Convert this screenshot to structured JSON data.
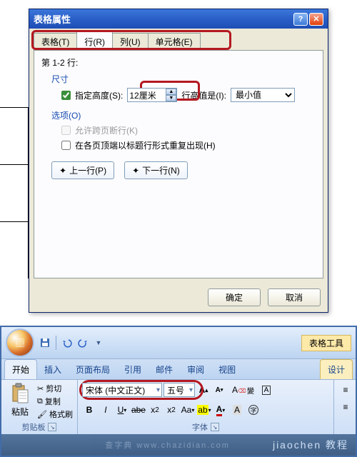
{
  "dialog": {
    "title": "表格属性",
    "tabs": [
      "表格(T)",
      "行(R)",
      "列(U)",
      "单元格(E)"
    ],
    "row_label": "第 1-2 行:",
    "size_label": "尺寸",
    "specify_height": "指定高度(S):",
    "height_value": "12厘米",
    "row_height_is": "行高值是(I):",
    "row_height_mode": "最小值",
    "options_label": "选项(O)",
    "allow_break": "允许跨页断行(K)",
    "repeat_header": "在各页顶端以标题行形式重复出现(H)",
    "prev_row": "上一行(P)",
    "next_row": "下一行(N)",
    "ok": "确定",
    "cancel": "取消"
  },
  "ribbon": {
    "context_tool": "表格工具",
    "tabs": [
      "开始",
      "插入",
      "页面布局",
      "引用",
      "邮件",
      "审阅",
      "视图"
    ],
    "context_tab": "设计",
    "clipboard": {
      "paste": "粘贴",
      "cut": "剪切",
      "copy": "复制",
      "format_painter": "格式刷",
      "group_label": "剪贴板"
    },
    "font": {
      "name": "宋体 (中文正文)",
      "size": "五号",
      "group_label": "字体"
    }
  },
  "watermark": "jiaochen 教程"
}
